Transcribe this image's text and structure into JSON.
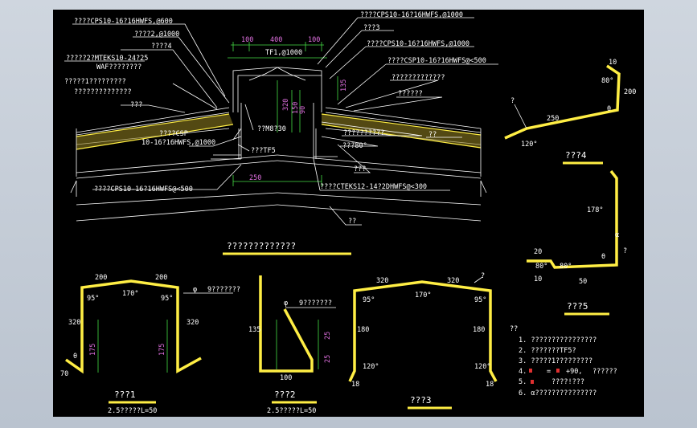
{
  "main_labels": {
    "l1": "????CPS10-16?16HWFS,@600",
    "l2": "????2,@1000",
    "l3": "????4",
    "l4": "?????2?MTEKS10-24?25",
    "l5": "WAF????????",
    "l6": "?????1?????????",
    "l7": "??????????????",
    "l8": "???",
    "l9": "????CSP",
    "l10": "10-16?16HWFS,@1000",
    "l11": "???TF5",
    "l12": "??M8?30",
    "l13": "????CPS10-16?16HWFS@<500",
    "r1": "????CPS10-16?16HWFS,@1000",
    "r2": "???3",
    "r3": "????CPS10-16?16HWFS,@1000",
    "r4": "????CSP10-16?16HWFS@<500",
    "r5": "?????????????",
    "r6": "??????",
    "r7": "??????????",
    "r8": "???80°",
    "r9": "??",
    "r10": "???",
    "r11": "????CTEKS12-14?2DHWFS@<300",
    "r12": "??",
    "tf": "TF1,@1000",
    "section_title": "?????????????"
  },
  "main_dims": {
    "d100a": "100",
    "d400": "400",
    "d100b": "100",
    "d135": "135",
    "d320": "320",
    "d150": "150",
    "d90": "90",
    "d250": "250"
  },
  "f1": {
    "d200a": "200",
    "d200b": "200",
    "a170": "170°",
    "a95a": "95°",
    "a95b": "95°",
    "d320a": "320",
    "d320b": "320",
    "d175a": "175",
    "d175b": "175",
    "d70": "70",
    "theta": "θ",
    "phi": "φ",
    "note": "9???????",
    "title": "???1",
    "spec": "2.5?????L=50"
  },
  "f2": {
    "d135": "135",
    "d25a": "25",
    "d25b": "25",
    "d100": "100",
    "phi": "φ",
    "note": "9???????",
    "title": "???2",
    "spec": "2.5?????L=50"
  },
  "f3": {
    "d320a": "320",
    "d320b": "320",
    "a170": "170°",
    "a95a": "95°",
    "a95b": "95°",
    "d180a": "180",
    "d180b": "180",
    "a120a": "120°",
    "a120b": "120°",
    "d18a": "18",
    "d18b": "18",
    "q": "?",
    "title": "???3"
  },
  "f4": {
    "d10": "10",
    "a80": "80°",
    "d200": "200",
    "d250": "250",
    "a120": "120°",
    "theta": "θ",
    "q": "?",
    "title": "???4"
  },
  "f5": {
    "a178": "178°",
    "alpha": "α",
    "d20": "20",
    "a80a": "80°",
    "a80b": "80°",
    "d10": "10",
    "d50": "50",
    "theta": "θ",
    "q": "?",
    "title": "???5"
  },
  "notes": {
    "head": "??",
    "n1": "1.  ????????????????",
    "n2": "2.  ???????TF5?",
    "n3": "3.  ?????1?????????",
    "n4": "4.",
    "n4b": "=",
    "n4c": "+90,",
    "n4d": "??????",
    "n5": "5.",
    "n5b": "????!???",
    "n6": "6.  α???????????????"
  },
  "colors": {
    "background": "#000000",
    "profile": "#ffee44",
    "dimension": "#44dd44",
    "text": "#ffffff",
    "dimension_text": "#e070e0"
  }
}
